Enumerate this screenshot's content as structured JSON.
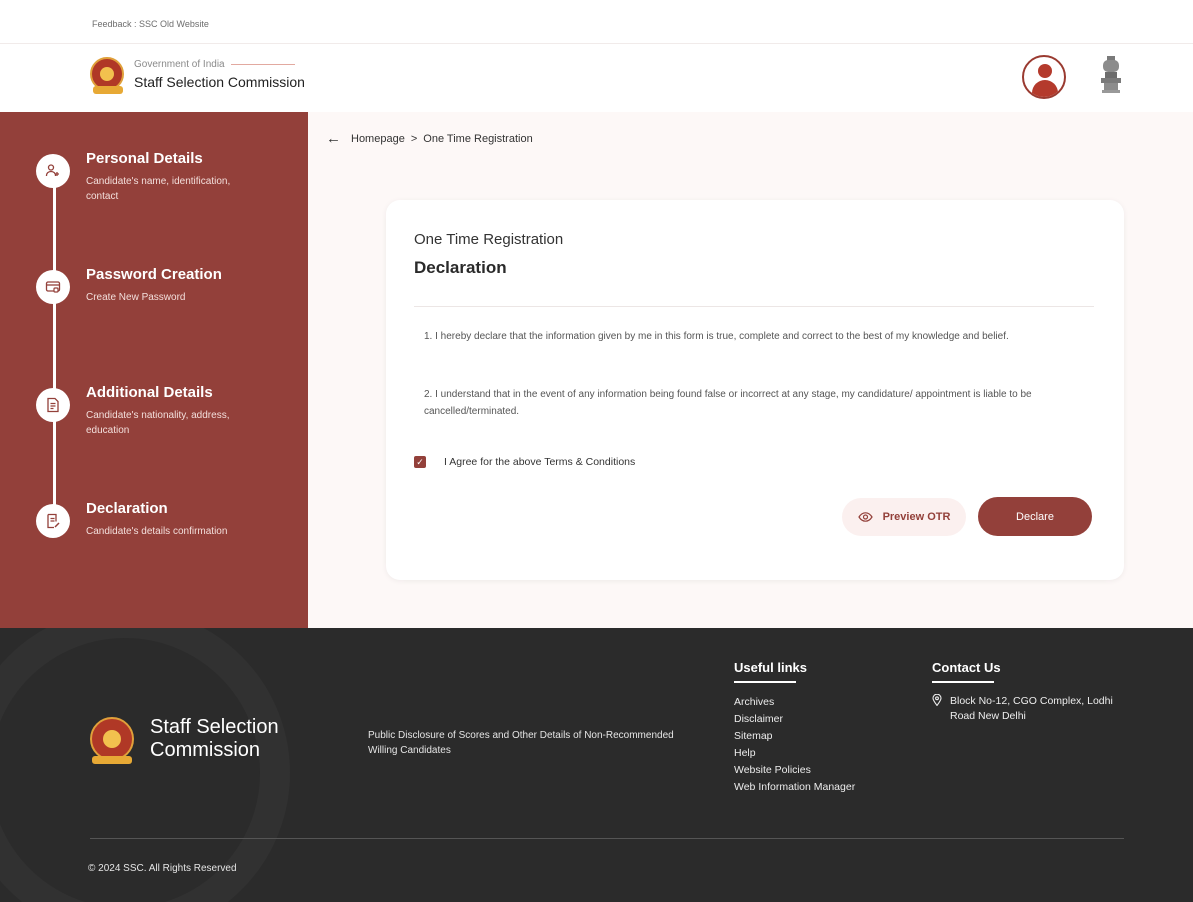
{
  "topstrip": {
    "links": "Feedback : SSC Old Website"
  },
  "header": {
    "gov": "Government of India",
    "org": "Staff Selection Commission",
    "profile_icon": "user-profile-icon",
    "emblem_icon": "national-emblem-icon"
  },
  "sidebar": {
    "steps": [
      {
        "title": "Personal Details",
        "desc": "Candidate's name, identification, contact",
        "icon": "user-add-icon"
      },
      {
        "title": "Password Creation",
        "desc": "Create New Password",
        "icon": "password-card-icon"
      },
      {
        "title": "Additional Details",
        "desc": "Candidate's nationality, address, education",
        "icon": "document-add-icon"
      },
      {
        "title": "Declaration",
        "desc": "Candidate's details confirmation",
        "icon": "document-edit-icon"
      }
    ]
  },
  "breadcrumb": {
    "home": "Homepage",
    "separator": ">",
    "current": "One Time Registration"
  },
  "card": {
    "subtitle": "One Time Registration",
    "title": "Declaration",
    "declarations": [
      "1. I hereby declare that the information given by me in this form is true, complete and correct to the best of my knowledge and belief.",
      "2. I understand that in the event of any information being found false or incorrect at any stage, my candidature/ appointment is liable to be cancelled/terminated."
    ],
    "agree_label": "I Agree for the above Terms & Conditions",
    "agree_checked": true,
    "preview_label": "Preview OTR",
    "declare_label": "Declare"
  },
  "footer": {
    "brand": "Staff Selection Commission",
    "disclosure": "Public Disclosure of Scores and Other Details of Non-Recommended Willing Candidates",
    "useful_links_title": "Useful links",
    "useful_links": [
      "Archives",
      "Disclaimer",
      "Sitemap",
      "Help",
      "Website Policies",
      "Web Information Manager"
    ],
    "contact_title": "Contact Us",
    "address": "Block No-12, CGO Complex, Lodhi Road New Delhi",
    "copyright": "© 2024 SSC. All Rights Reserved"
  },
  "colors": {
    "primary": "#93403a",
    "footer_bg": "#2b2b2b",
    "page_bg": "#fdf8f7"
  }
}
